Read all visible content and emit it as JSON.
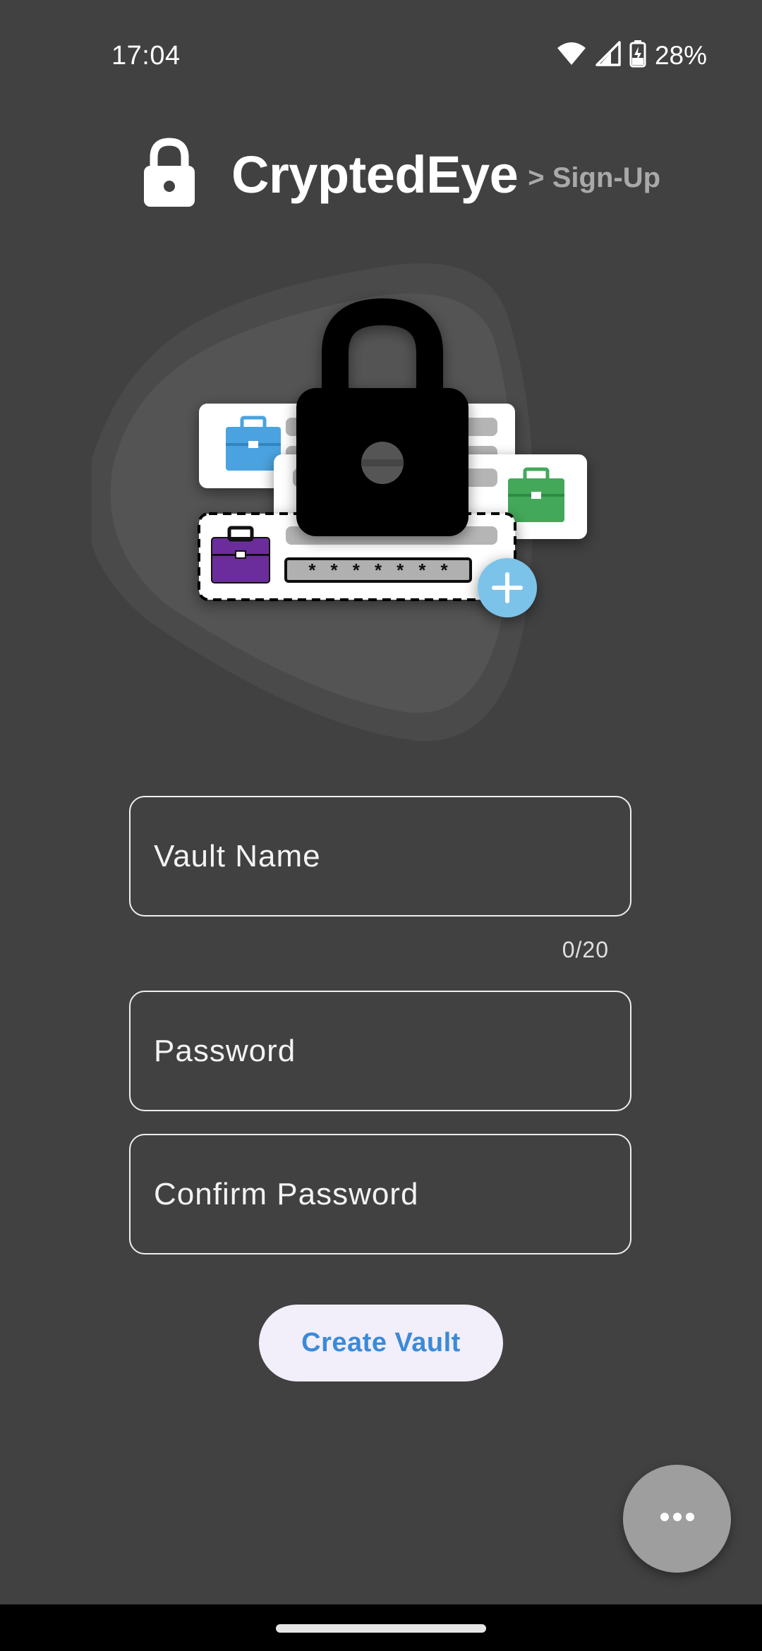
{
  "status_bar": {
    "time": "17:04",
    "battery": "28%"
  },
  "header": {
    "title": "CryptedEye",
    "subtitle": "> Sign-Up"
  },
  "illustration": {
    "password_mask": "* * * * * * *",
    "colors": {
      "blue_case": "#4aa3e0",
      "green_case": "#43a85a",
      "purple_case": "#6b2d9c",
      "plus_button": "#7cc3ea"
    }
  },
  "form": {
    "vault_name_label": "Vault Name",
    "vault_name_counter": "0/20",
    "password_label": "Password",
    "confirm_password_label": "Confirm Password",
    "submit_label": "Create Vault"
  },
  "colors": {
    "background": "#414141",
    "button_text": "#3b8ad9",
    "button_bg": "#f2eefa"
  }
}
